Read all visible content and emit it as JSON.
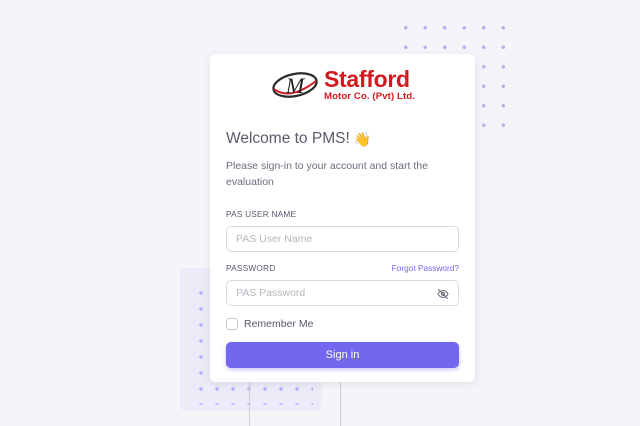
{
  "logo": {
    "monogram": "M",
    "name": "Stafford",
    "subtitle": "Motor Co. (Pvt) Ltd."
  },
  "welcome": {
    "title": "Welcome to PMS!",
    "emoji": "👋",
    "subtitle": "Please sign-in to your account and start the evaluation"
  },
  "username": {
    "label": "PAS USER NAME",
    "placeholder": "PAS User Name",
    "value": ""
  },
  "password": {
    "label": "PASSWORD",
    "forgot_link": "Forgot Password?",
    "placeholder": "PAS Password",
    "value": "",
    "toggle_icon": "eye-off-icon"
  },
  "remember": {
    "label": "Remember Me",
    "checked": false
  },
  "signin": {
    "label": "Sign in"
  },
  "colors": {
    "primary": "#7367f0",
    "brand_red": "#d2191e",
    "background": "#f5f5f9"
  }
}
